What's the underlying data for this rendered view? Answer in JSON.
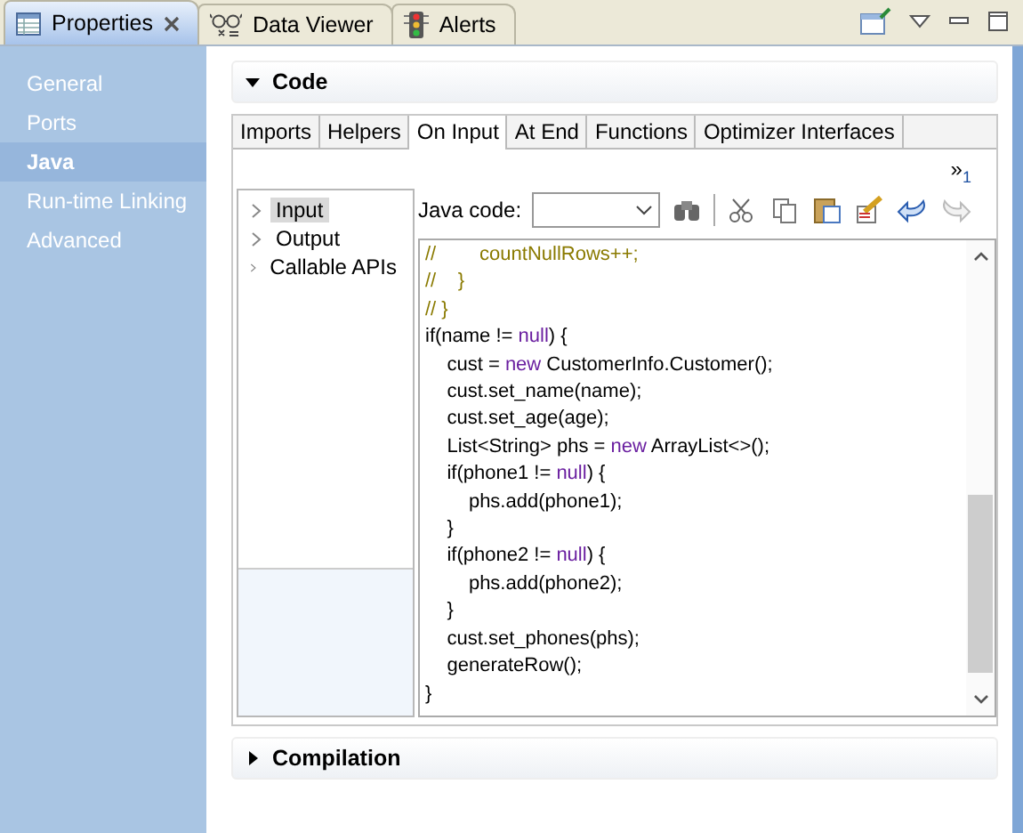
{
  "view_tabs": [
    {
      "label": "Properties",
      "selected": true
    },
    {
      "label": "Data Viewer",
      "selected": false
    },
    {
      "label": "Alerts",
      "selected": false
    }
  ],
  "sidebar": {
    "items": [
      {
        "label": "General",
        "selected": false
      },
      {
        "label": "Ports",
        "selected": false
      },
      {
        "label": "Java",
        "selected": true
      },
      {
        "label": "Run-time Linking",
        "selected": false
      },
      {
        "label": "Advanced",
        "selected": false
      }
    ]
  },
  "sections": [
    {
      "title": "Code",
      "expanded": true
    },
    {
      "title": "Compilation",
      "expanded": false
    }
  ],
  "code_tabs": [
    {
      "label": "Imports",
      "selected": false
    },
    {
      "label": "Helpers",
      "selected": false
    },
    {
      "label": "On Input",
      "selected": true
    },
    {
      "label": "At End",
      "selected": false
    },
    {
      "label": "Functions",
      "selected": false
    },
    {
      "label": "Optimizer Interfaces",
      "selected": false
    }
  ],
  "overflow": {
    "mark": "»",
    "count": "1"
  },
  "tree": [
    {
      "label": "Input",
      "selected": true
    },
    {
      "label": "Output",
      "selected": false
    },
    {
      "label": "Callable APIs",
      "selected": false
    }
  ],
  "java_code": {
    "label": "Java code:",
    "toolbar": [
      {
        "kind": "find",
        "disabled": false
      },
      {
        "kind": "cut",
        "disabled": false
      },
      {
        "kind": "copy",
        "disabled": false
      },
      {
        "kind": "paste",
        "disabled": false
      },
      {
        "kind": "format",
        "disabled": false
      },
      {
        "kind": "undo",
        "disabled": false
      },
      {
        "kind": "redo",
        "disabled": true
      }
    ]
  },
  "code_lines": [
    [
      {
        "kind": "comment",
        "text": "//        countNullRows++;"
      }
    ],
    [
      {
        "kind": "comment",
        "text": "//    }"
      }
    ],
    [
      {
        "kind": "comment",
        "text": "// }"
      }
    ],
    [
      {
        "kind": "plain",
        "text": "if(name != "
      },
      {
        "kind": "keyword",
        "text": "null"
      },
      {
        "kind": "plain",
        "text": ") {"
      }
    ],
    [
      {
        "kind": "plain",
        "text": "    cust = "
      },
      {
        "kind": "keyword",
        "text": "new"
      },
      {
        "kind": "plain",
        "text": " CustomerInfo.Customer();"
      }
    ],
    [
      {
        "kind": "plain",
        "text": "    cust.set_name(name);"
      }
    ],
    [
      {
        "kind": "plain",
        "text": "    cust.set_age(age);"
      }
    ],
    [
      {
        "kind": "plain",
        "text": "    List<String> phs = "
      },
      {
        "kind": "keyword",
        "text": "new"
      },
      {
        "kind": "plain",
        "text": " ArrayList<>();"
      }
    ],
    [
      {
        "kind": "plain",
        "text": "    if(phone1 != "
      },
      {
        "kind": "keyword",
        "text": "null"
      },
      {
        "kind": "plain",
        "text": ") {"
      }
    ],
    [
      {
        "kind": "plain",
        "text": "        phs.add(phone1);"
      }
    ],
    [
      {
        "kind": "plain",
        "text": "    }"
      }
    ],
    [
      {
        "kind": "plain",
        "text": "    if(phone2 != "
      },
      {
        "kind": "keyword",
        "text": "null"
      },
      {
        "kind": "plain",
        "text": ") {"
      }
    ],
    [
      {
        "kind": "plain",
        "text": "        phs.add(phone2);"
      }
    ],
    [
      {
        "kind": "plain",
        "text": "    }"
      }
    ],
    [
      {
        "kind": "plain",
        "text": "    cust.set_phones(phs);"
      }
    ],
    [
      {
        "kind": "plain",
        "text": "    generateRow();"
      }
    ],
    [
      {
        "kind": "plain",
        "text": "}"
      }
    ]
  ]
}
